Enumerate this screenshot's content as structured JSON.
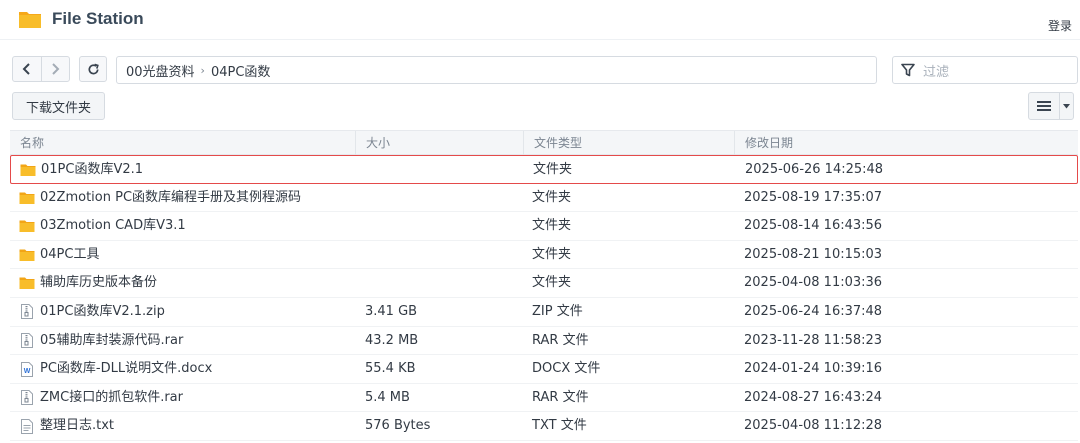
{
  "app": {
    "title": "File Station",
    "login_label": "登录"
  },
  "toolbar": {
    "breadcrumb": [
      "00光盘资料",
      "04PC函数"
    ],
    "breadcrumb_separator": "›",
    "filter_placeholder": "过滤",
    "download_label": "下载文件夹"
  },
  "table": {
    "headers": {
      "name": "名称",
      "size": "大小",
      "type": "文件类型",
      "date": "修改日期"
    },
    "rows": [
      {
        "icon": "folder-icon",
        "name": "01PC函数库V2.1",
        "size": "",
        "type": "文件夹",
        "date": "2025-06-26 14:25:48",
        "highlighted": true
      },
      {
        "icon": "folder-icon",
        "name": "02Zmotion PC函数库编程手册及其例程源码",
        "size": "",
        "type": "文件夹",
        "date": "2025-08-19 17:35:07"
      },
      {
        "icon": "folder-icon",
        "name": "03Zmotion CAD库V3.1",
        "size": "",
        "type": "文件夹",
        "date": "2025-08-14 16:43:56"
      },
      {
        "icon": "folder-icon",
        "name": "04PC工具",
        "size": "",
        "type": "文件夹",
        "date": "2025-08-21 10:15:03"
      },
      {
        "icon": "folder-icon",
        "name": "辅助库历史版本备份",
        "size": "",
        "type": "文件夹",
        "date": "2025-04-08 11:03:36"
      },
      {
        "icon": "archive-icon",
        "name": "01PC函数库V2.1.zip",
        "size": "3.41 GB",
        "type": "ZIP 文件",
        "date": "2025-06-24 16:37:48"
      },
      {
        "icon": "archive-icon",
        "name": "05辅助库封装源代码.rar",
        "size": "43.2 MB",
        "type": "RAR 文件",
        "date": "2023-11-28 11:58:23"
      },
      {
        "icon": "word-doc-icon",
        "name": "PC函数库-DLL说明文件.docx",
        "size": "55.4 KB",
        "type": "DOCX 文件",
        "date": "2024-01-24 10:39:16"
      },
      {
        "icon": "archive-icon",
        "name": "ZMC接口的抓包软件.rar",
        "size": "5.4 MB",
        "type": "RAR 文件",
        "date": "2024-08-27 16:43:24"
      },
      {
        "icon": "text-file-icon",
        "name": "整理日志.txt",
        "size": "576 Bytes",
        "type": "TXT 文件",
        "date": "2025-04-08 11:12:28"
      }
    ]
  },
  "colors": {
    "folder": "#f6b51d",
    "highlight_border": "#e44a4a",
    "header_bg": "#f4f6f8",
    "word_blue": "#2b6fd6"
  }
}
